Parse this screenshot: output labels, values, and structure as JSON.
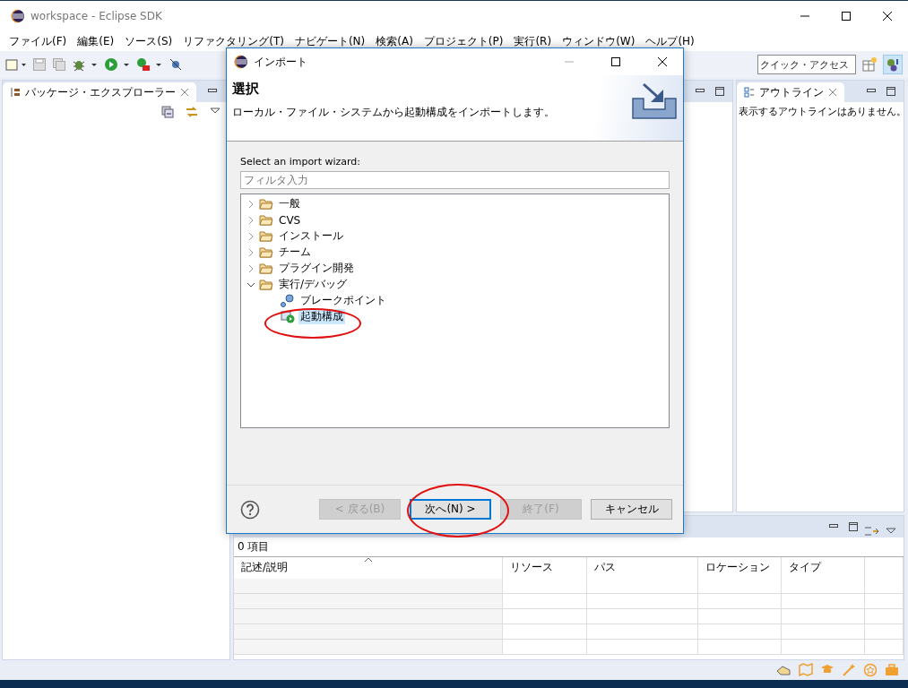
{
  "window": {
    "title": "workspace - Eclipse SDK"
  },
  "menu": [
    "ファイル(F)",
    "編集(E)",
    "ソース(S)",
    "リファクタリング(T)",
    "ナビゲート(N)",
    "検索(A)",
    "プロジェクト(P)",
    "実行(R)",
    "ウィンドウ(W)",
    "ヘルプ(H)"
  ],
  "toolbar": {
    "quick_access": {
      "placeholder": "クイック・アクセス"
    }
  },
  "left_view": {
    "tab": {
      "label": "パッケージ・エクスプローラー",
      "selected": true
    }
  },
  "outline_view": {
    "tab": {
      "label": "アウトライン",
      "selected": true
    },
    "message": "表示するアウトラインはありません。"
  },
  "problems_view": {
    "count": "0 項目",
    "columns": [
      "記述/説明",
      "リソース",
      "パス",
      "ロケーション",
      "タイプ"
    ]
  },
  "dialog": {
    "title": "インポート",
    "heading": "選択",
    "description": "ローカル・ファイル・システムから起動構成をインポートします。",
    "prompt": "Select an import wizard:",
    "filter": {
      "placeholder": "フィルタ入力"
    },
    "tree": [
      {
        "label": "一般",
        "kind": "folder",
        "expanded": false,
        "selected": false
      },
      {
        "label": "CVS",
        "kind": "folder",
        "expanded": false,
        "selected": false
      },
      {
        "label": "インストール",
        "kind": "folder",
        "expanded": false,
        "selected": false
      },
      {
        "label": "チーム",
        "kind": "folder",
        "expanded": false,
        "selected": false
      },
      {
        "label": "プラグイン開発",
        "kind": "folder",
        "expanded": false,
        "selected": false
      },
      {
        "label": "実行/デバッグ",
        "kind": "folder",
        "expanded": true,
        "selected": false,
        "children": [
          {
            "label": "ブレークポイント",
            "kind": "breakpoint",
            "selected": false
          },
          {
            "label": "起動構成",
            "kind": "launch",
            "selected": true
          }
        ]
      }
    ],
    "buttons": [
      {
        "label": "< 戻る(B)",
        "disabled": true,
        "default": false
      },
      {
        "label": "次へ(N) >",
        "disabled": false,
        "default": true
      },
      {
        "label": "終了(F)",
        "disabled": true,
        "default": false
      },
      {
        "label": "キャンセル",
        "disabled": false,
        "default": false
      }
    ]
  }
}
